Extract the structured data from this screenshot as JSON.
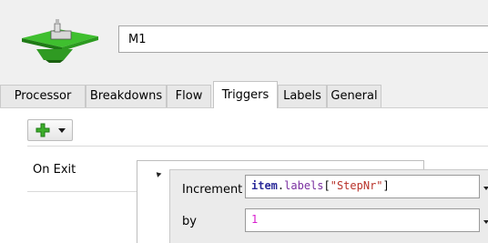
{
  "object": {
    "icon": "processor-machine-icon",
    "name": "M1"
  },
  "tabs": [
    {
      "label": "Processor"
    },
    {
      "label": "Breakdowns"
    },
    {
      "label": "Flow"
    },
    {
      "label": "Triggers",
      "active": true
    },
    {
      "label": "Labels"
    },
    {
      "label": "General"
    }
  ],
  "toolbar": {
    "add_icon": "plus-icon",
    "dropdown_icon": "chevron-down-icon"
  },
  "trigger": {
    "name": "On Exit",
    "increment_label": "Increment",
    "increment_code": {
      "keyword": "item",
      "dot": ".",
      "property": "labels",
      "open": "[",
      "string": "\"StepNr\"",
      "close": "]"
    },
    "by_label": "by",
    "by_value": "1"
  },
  "colors": {
    "background": "#f0f0f0",
    "panel": "#ffffff",
    "keyword": "#2b2b9a",
    "property": "#7a2fa0",
    "string": "#b8322a",
    "number": "#d81ecf",
    "plus_green": "#3dae2b"
  }
}
